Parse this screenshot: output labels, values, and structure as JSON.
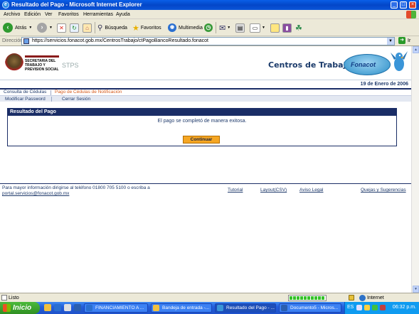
{
  "window": {
    "title": "Resultado del Pago - Microsoft Internet Explorer",
    "minimize": "_",
    "maximize": "□",
    "close": "×"
  },
  "menu": [
    "Archivo",
    "Edición",
    "Ver",
    "Favoritos",
    "Herramientas",
    "Ayuda"
  ],
  "toolbar": {
    "back_label": "Atrás",
    "search_label": "Búsqueda",
    "favorites_label": "Favoritos",
    "media_label": "Multimedia"
  },
  "address": {
    "label": "Dirección",
    "url": "https://servicios.fonacot.gob.mx/CentrosTrabajo/ctPagoBancoResultado.fonacot",
    "go_label": "Ir"
  },
  "header": {
    "stps_text_1": "SECRETARIA DEL",
    "stps_text_2": "TRABAJO Y",
    "stps_text_3": "PREVISION SOCIAL",
    "stps_abbr": "STPS",
    "page_title": "Centros de Trabajo",
    "fonacot_brand": "Fonacot",
    "date": "19 de Enero de 2006"
  },
  "nav": {
    "consulta": "Consulta de Cédulas",
    "pago": "Pago de Cédulas de Notificación",
    "password": "Modificar Password",
    "cerrar": "Cerrar Sesión"
  },
  "result": {
    "header": "Resultado del Pago",
    "message": "El pago se completó de manera exitosa.",
    "button": "Continuar"
  },
  "footer": {
    "info_line1": "Para mayor información dirigirse al teléfono 01800 705 5100 o escriba a",
    "email": "portal.servicios@fonacot.gob.mx",
    "tutorial": "Tutorial",
    "layout": "Layout(CSV)",
    "aviso": "Aviso Legal",
    "quejas": "Quejas y Sugerencias"
  },
  "status": {
    "text": "Listo",
    "zone": "Internet"
  },
  "taskbar": {
    "start": "Inicio",
    "tasks": [
      "FINANCIAMIENTO A ...",
      "Bandeja de entrada -...",
      "Resultado del Pago - ...",
      "Documento5 - Micros..."
    ],
    "lang": "ES",
    "clock": "06:32 p.m."
  },
  "colors": {
    "brand_navy": "#1a2d66",
    "active_link": "#d4591b",
    "button_orange": "#f5a623"
  }
}
